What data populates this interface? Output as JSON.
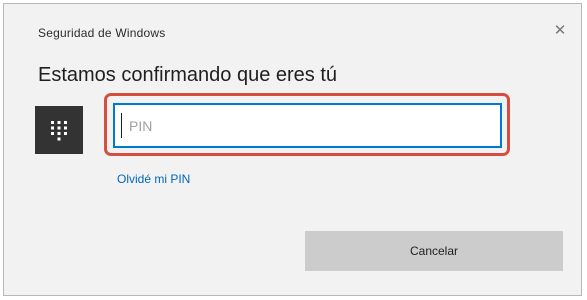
{
  "dialog": {
    "title": "Seguridad de Windows",
    "close_glyph": "✕",
    "heading": "Estamos confirmando que eres tú",
    "keypad_icon": "keypad-icon",
    "pin_input": {
      "placeholder": "PIN",
      "value": ""
    },
    "forgot_link": "Olvidé mi PIN",
    "cancel_label": "Cancelar"
  },
  "colors": {
    "accent": "#0078d7",
    "link": "#0067b8",
    "highlight": "#d64f3e",
    "tile": "#333333",
    "button": "#cccccc"
  }
}
